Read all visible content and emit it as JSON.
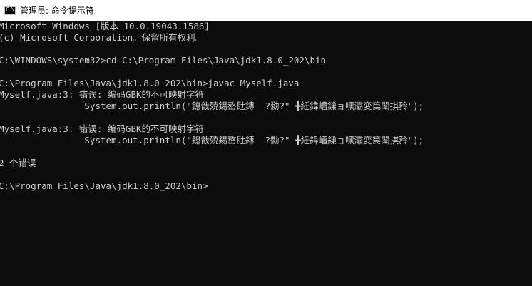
{
  "window": {
    "title": "管理员: 命令提示符",
    "icon": "cmd-icon",
    "icon_glyph": "C:\\",
    "colors": {
      "titlebar": "#ffffff",
      "console_bg": "#0c0c0c",
      "console_fg": "#cccccc"
    }
  },
  "console": {
    "lines": [
      "Microsoft Windows [版本 10.0.19043.1586]",
      "(c) Microsoft Corporation。保留所有权利。",
      "",
      "C:\\WINDOWS\\system32>cd C:\\Program Files\\Java\\jdk1.8.0_202\\bin",
      "",
      "C:\\Program Files\\Java\\jdk1.8.0_202\\bin>javac Myself.java",
      "Myself.java:3: 错误: 编码GBK的不可映射字符",
      "                System.out.println(\"鎴戠殑鍚嶅瓧鏄  ?勬?\" ╋紝鍏嶆鏁ョ嘿灞変笢闈掑矝\");",
      "",
      "Myself.java:3: 错误: 编码GBK的不可映射字符",
      "                System.out.println(\"鎴戠殑鍚嶅瓧鏄  ?勬?\" ╋紝鍏嶆鏁ョ嘿灞変笢闈掑矝\");",
      "",
      "2 个错误",
      "",
      "C:\\Program Files\\Java\\jdk1.8.0_202\\bin>"
    ]
  }
}
